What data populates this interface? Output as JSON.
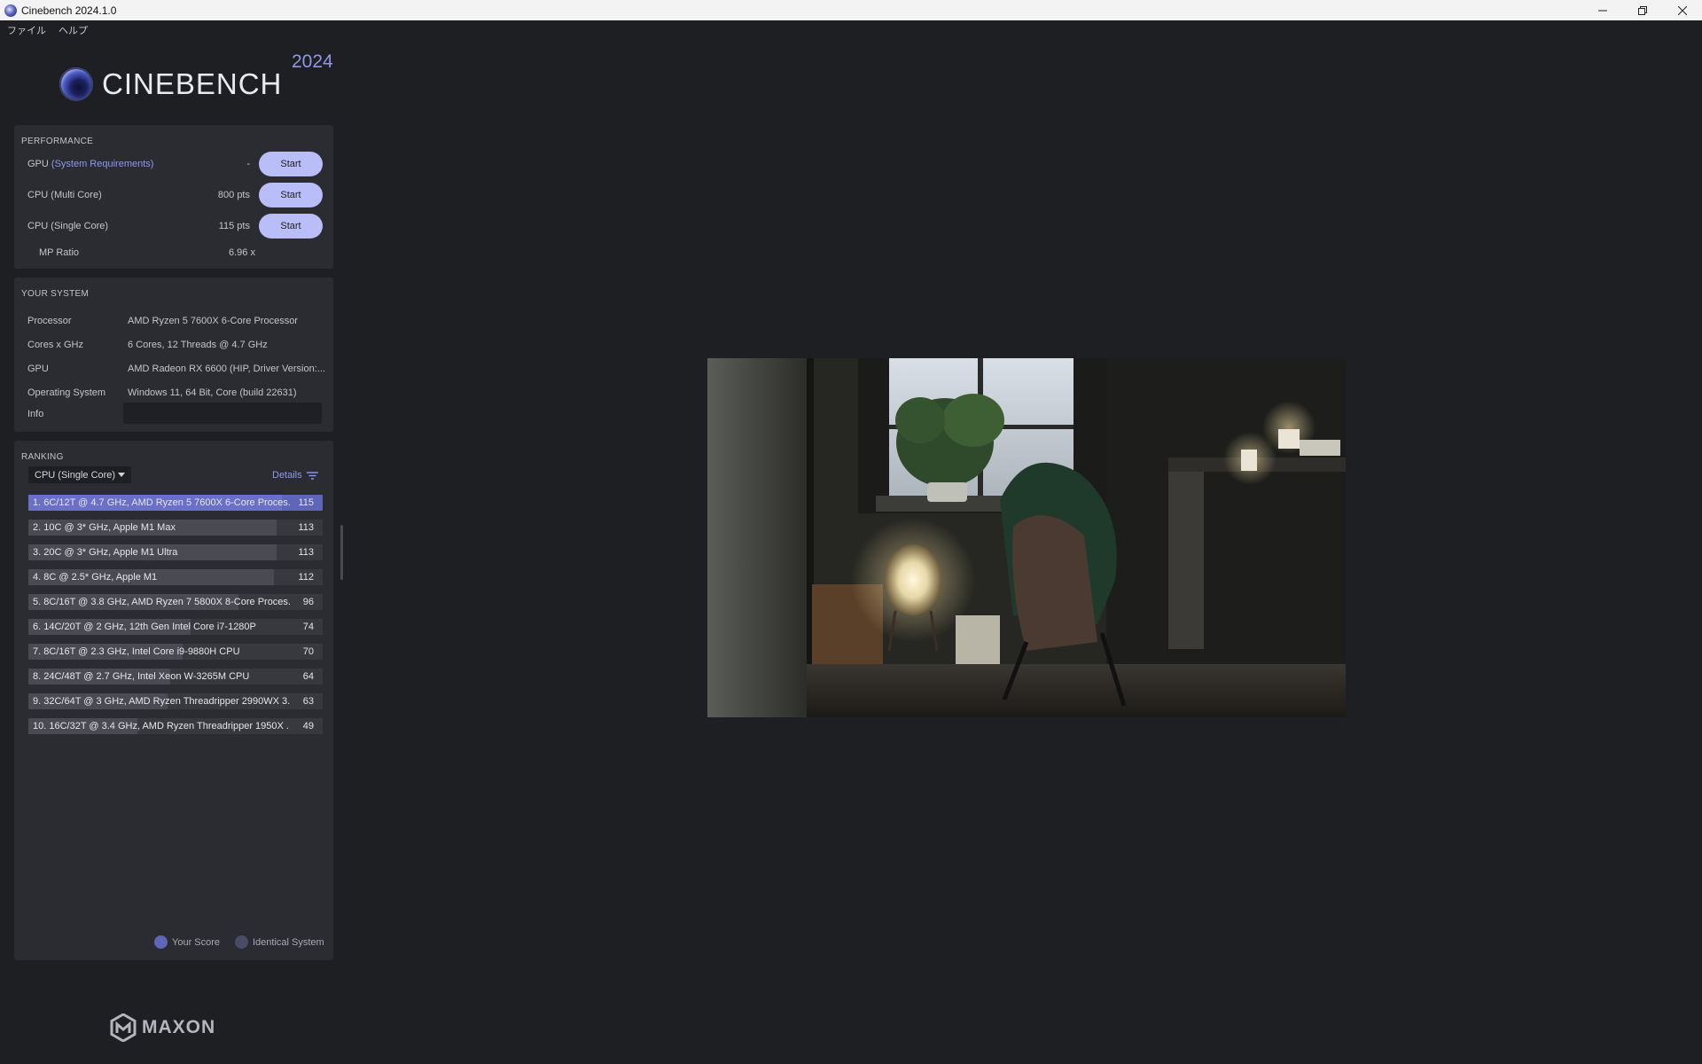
{
  "window": {
    "title": "Cinebench 2024.1.0"
  },
  "menu": {
    "items": [
      "ファイル",
      "ヘルプ"
    ]
  },
  "logo": {
    "name": "CINEBENCH",
    "year": "2024"
  },
  "performance": {
    "header": "PERFORMANCE",
    "gpu": {
      "label": "GPU",
      "link": "(System Requirements)",
      "value": "-",
      "button": "Start"
    },
    "cpu_multi": {
      "label": "CPU (Multi Core)",
      "value": "800 pts",
      "button": "Start"
    },
    "cpu_single": {
      "label": "CPU (Single Core)",
      "value": "115 pts",
      "button": "Start"
    },
    "mp_ratio": {
      "label": "MP Ratio",
      "value": "6.96 x"
    }
  },
  "system": {
    "header": "YOUR SYSTEM",
    "rows": [
      {
        "label": "Processor",
        "value": "AMD Ryzen 5 7600X 6-Core Processor"
      },
      {
        "label": "Cores x GHz",
        "value": "6 Cores, 12 Threads @ 4.7 GHz"
      },
      {
        "label": "GPU",
        "value": "AMD Radeon RX 6600 (HIP, Driver Version:..."
      },
      {
        "label": "Operating System",
        "value": "Windows 11, 64 Bit, Core (build 22631)"
      },
      {
        "label": "Info",
        "value": ""
      }
    ]
  },
  "ranking": {
    "header": "RANKING",
    "selected": "CPU (Single Core)",
    "details": "Details",
    "items": [
      {
        "text": "1. 6C/12T @ 4.7 GHz, AMD Ryzen 5 7600X 6-Core Proces...",
        "score": "115",
        "level": 1.0
      },
      {
        "text": "2. 10C @ 3* GHz, Apple M1 Max",
        "score": "113",
        "level": 0.98
      },
      {
        "text": "3. 20C @ 3* GHz, Apple M1 Ultra",
        "score": "113",
        "level": 0.98
      },
      {
        "text": "4. 8C @ 2.5* GHz, Apple M1",
        "score": "112",
        "level": 0.97
      },
      {
        "text": "5. 8C/16T @ 3.8 GHz, AMD Ryzen 7 5800X 8-Core Proces...",
        "score": "96",
        "level": 0.83
      },
      {
        "text": "6. 14C/20T @ 2 GHz, 12th Gen Intel Core i7-1280P",
        "score": "74",
        "level": 0.64
      },
      {
        "text": "7. 8C/16T @ 2.3 GHz, Intel Core i9-9880H CPU",
        "score": "70",
        "level": 0.61
      },
      {
        "text": "8. 24C/48T @ 2.7 GHz, Intel Xeon W-3265M CPU",
        "score": "64",
        "level": 0.56
      },
      {
        "text": "9. 32C/64T @ 3 GHz, AMD Ryzen Threadripper 2990WX 3...",
        "score": "63",
        "level": 0.55
      },
      {
        "text": "10. 16C/32T @ 3.4 GHz, AMD Ryzen Threadripper 1950X ...",
        "score": "49",
        "level": 0.43
      }
    ],
    "legend": [
      {
        "label": "Your Score",
        "color": "#5f65b8"
      },
      {
        "label": "Identical System",
        "color": "#4a4c66"
      }
    ]
  },
  "brand": {
    "name": "MAXON"
  }
}
